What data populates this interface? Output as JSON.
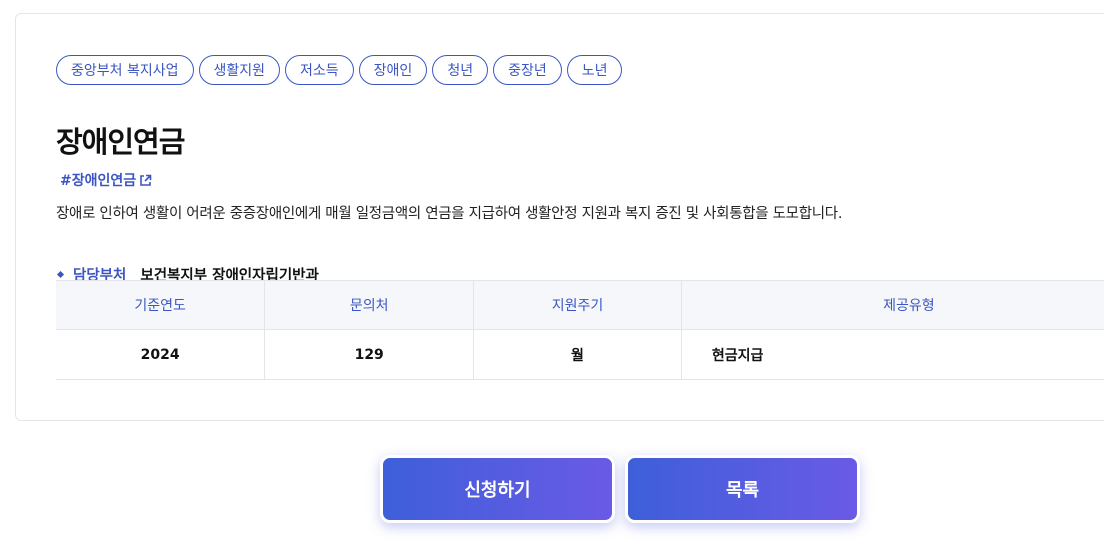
{
  "tags": [
    "중앙부처 복지사업",
    "생활지원",
    "저소득",
    "장애인",
    "청년",
    "중장년",
    "노년"
  ],
  "title": "장애인연금",
  "hashtag": "#장애인연금",
  "description": "장애로 인하여 생활이 어려운 중증장애인에게 매월 일정금액의 연금을 지급하여 생활안정 지원과 복지 증진 및 사회통합을 도모합니다.",
  "department": {
    "label": "담당부처",
    "value": "보건복지부 장애인자립기반과"
  },
  "table": {
    "headers": [
      "기준연도",
      "문의처",
      "지원주기",
      "제공유형"
    ],
    "row": [
      "2024",
      "129",
      "월",
      "현금지급"
    ]
  },
  "buttons": {
    "apply": "신청하기",
    "list": "목록"
  },
  "colors": {
    "accent": "#3b56c4",
    "button_from": "#3e5fd9",
    "button_to": "#6a5ae6"
  }
}
